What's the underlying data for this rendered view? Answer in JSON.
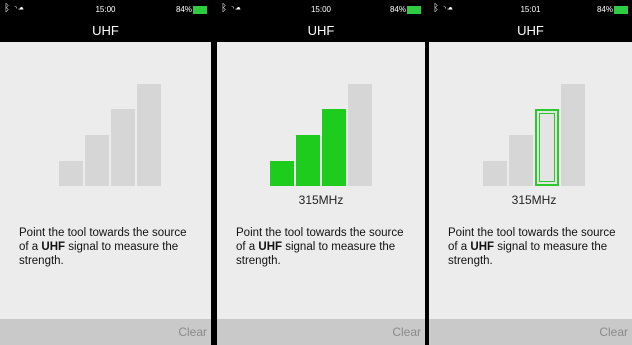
{
  "screens": [
    {
      "time": "15:00",
      "battery": "84%",
      "title": "UHF",
      "frequency": "",
      "message_parts": [
        "Point the tool towards the source of a ",
        "UHF",
        " signal to measure the strength."
      ],
      "clear_label": "Clear",
      "signal_bars": [
        "off",
        "off",
        "off",
        "off"
      ]
    },
    {
      "time": "15:00",
      "battery": "84%",
      "title": "UHF",
      "frequency": "315MHz",
      "message_parts": [
        "Point the tool towards the source of a ",
        "UHF",
        " signal to measure the strength."
      ],
      "clear_label": "Clear",
      "signal_bars": [
        "on",
        "on",
        "on",
        "off"
      ]
    },
    {
      "time": "15:01",
      "battery": "84%",
      "title": "UHF",
      "frequency": "315MHz",
      "message_parts": [
        "Point the tool towards the source of a ",
        "UHF",
        " signal to measure the strength."
      ],
      "clear_label": "Clear",
      "signal_bars": [
        "off",
        "off",
        "outline",
        "off"
      ]
    }
  ],
  "colors": {
    "active": "#1dcc1d",
    "inactive": "#d6d6d6",
    "background": "#ececec"
  },
  "icons": {
    "status": [
      "bluetooth-icon",
      "wifi-icon",
      "cloud-icon"
    ],
    "battery": "battery-icon"
  }
}
